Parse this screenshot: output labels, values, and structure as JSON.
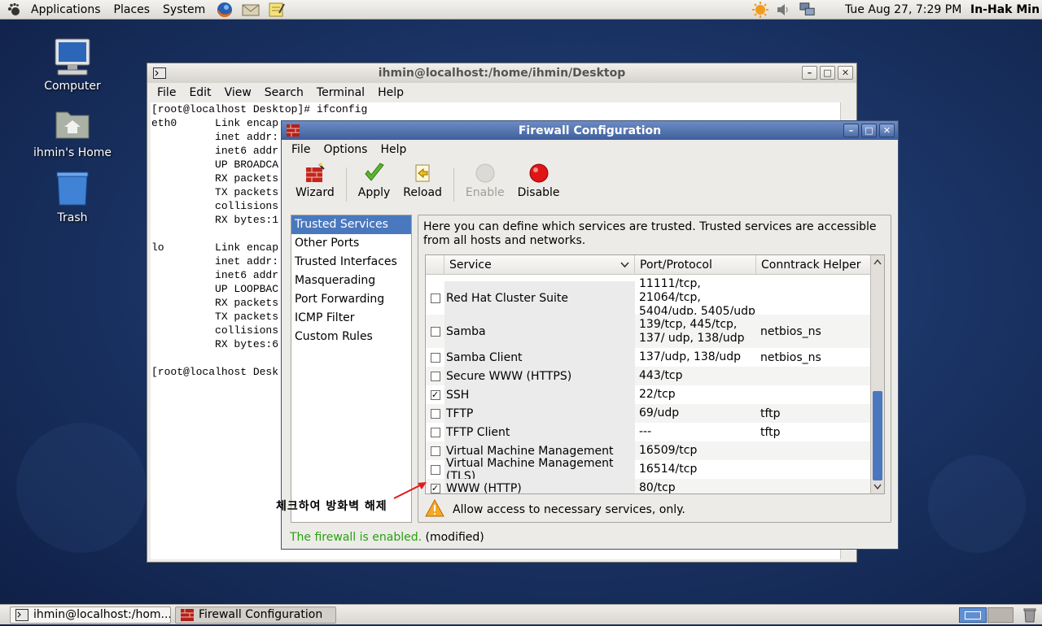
{
  "top_panel": {
    "menus": [
      "Applications",
      "Places",
      "System"
    ],
    "clock": "Tue Aug 27,  7:29 PM",
    "user": "In-Hak Min"
  },
  "desktop": {
    "icons": [
      {
        "label": "Computer",
        "icon": "computer-icon"
      },
      {
        "label": "ihmin's Home",
        "icon": "home-folder-icon"
      },
      {
        "label": "Trash",
        "icon": "trash-icon"
      }
    ]
  },
  "terminal": {
    "title": "ihmin@localhost:/home/ihmin/Desktop",
    "menus": [
      "File",
      "Edit",
      "View",
      "Search",
      "Terminal",
      "Help"
    ],
    "lines": [
      "[root@localhost Desktop]# ifconfig",
      "eth0      Link encap",
      "          inet addr:",
      "          inet6 addr",
      "          UP BROADCA",
      "          RX packets",
      "          TX packets",
      "          collisions",
      "          RX bytes:1",
      "",
      "lo        Link encap",
      "          inet addr:",
      "          inet6 addr",
      "          UP LOOPBAC",
      "          RX packets",
      "          TX packets",
      "          collisions",
      "          RX bytes:6",
      "",
      "[root@localhost Desk"
    ]
  },
  "firewall": {
    "title": "Firewall Configuration",
    "menus": [
      "File",
      "Options",
      "Help"
    ],
    "toolbar": {
      "wizard": "Wizard",
      "apply": "Apply",
      "reload": "Reload",
      "enable": "Enable",
      "disable": "Disable"
    },
    "nav": [
      "Trusted Services",
      "Other Ports",
      "Trusted Interfaces",
      "Masquerading",
      "Port Forwarding",
      "ICMP Filter",
      "Custom Rules"
    ],
    "description": "Here you can define which services are trusted. Trusted services are accessible from all hosts and networks.",
    "columns": [
      "Service",
      "Port/Protocol",
      "Conntrack Helper"
    ],
    "services": [
      {
        "name": "Red Hat Cluster Suite",
        "port": "11111/tcp, 21064/tcp, 5404/udp, 5405/udp",
        "helper": "",
        "checked": false
      },
      {
        "name": "Samba",
        "port": "139/tcp, 445/tcp, 137/ udp, 138/udp",
        "helper": "netbios_ns",
        "checked": false
      },
      {
        "name": "Samba Client",
        "port": "137/udp, 138/udp",
        "helper": "netbios_ns",
        "checked": false
      },
      {
        "name": "Secure WWW (HTTPS)",
        "port": "443/tcp",
        "helper": "",
        "checked": false
      },
      {
        "name": "SSH",
        "port": "22/tcp",
        "helper": "",
        "checked": true
      },
      {
        "name": "TFTP",
        "port": "69/udp",
        "helper": "tftp",
        "checked": false
      },
      {
        "name": "TFTP Client",
        "port": "---",
        "helper": "tftp",
        "checked": false
      },
      {
        "name": "Virtual Machine Management",
        "port": "16509/tcp",
        "helper": "",
        "checked": false
      },
      {
        "name": "Virtual Machine Management (TLS)",
        "port": "16514/tcp",
        "helper": "",
        "checked": false
      },
      {
        "name": "WWW (HTTP)",
        "port": "80/tcp",
        "helper": "",
        "checked": true
      }
    ],
    "warning": "Allow access to necessary services, only.",
    "status_enabled": "The firewall is enabled.",
    "status_modified": "(modified)"
  },
  "annotation": "체크하여 방화벽 해제",
  "taskbar": {
    "items": [
      "ihmin@localhost:/hom...",
      "Firewall Configuration"
    ]
  },
  "colors": {
    "selection": "#4a78be",
    "status_ok": "#26a30f",
    "annotation_arrow": "#e01b1b"
  }
}
